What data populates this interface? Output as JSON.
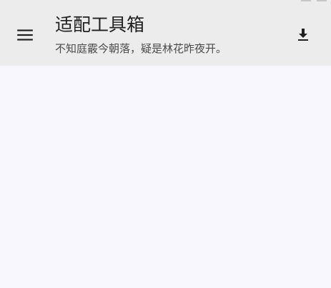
{
  "header": {
    "title": "适配工具箱",
    "subtitle": "不知庭霰今朝落，疑是林花昨夜开。",
    "menu_icon": "menu-icon",
    "download_icon": "download-icon"
  },
  "colors": {
    "appbar_bg": "#ececec",
    "page_bg": "#f8f7fd",
    "icon_color": "#1f1f1f"
  }
}
